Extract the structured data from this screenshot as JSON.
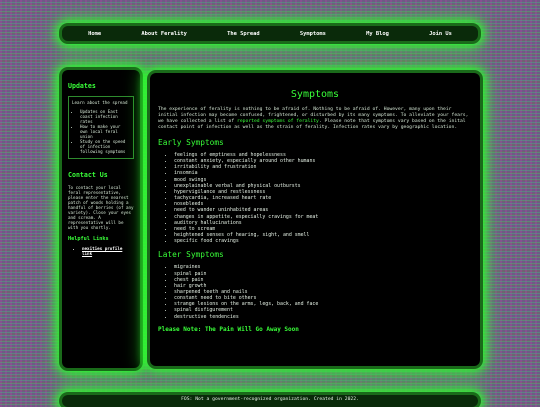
{
  "nav": {
    "items": [
      "Home",
      "About Ferality",
      "The Spread",
      "Symptoms",
      "My Blog",
      "Join Us"
    ]
  },
  "sidebar": {
    "updates_title": "Updates",
    "updates_intro": "Learn about the spread",
    "updates_items": [
      "Updates on East coast infection rates",
      "How to make your own local feral union",
      "Study on the speed of infection following symptoms"
    ],
    "contact_title": "Contact Us",
    "contact_text": "To contact your local feral representative, please enter the nearest patch of woods holding a handful of berries (of any variety). Close your eyes and scream. A representative will be with you shortly.",
    "helpful_title": "Helpful Links",
    "helpful_links": [
      "nexities profile link"
    ]
  },
  "main": {
    "title": "Symptoms",
    "intro_before": "The experience of ferality is nothing to be afraid of. Nothing to be afraid of. However, many upon their initial infection may become confused, frightened, or disturbed by its many symptoms. To alleviate your fears, we have collected a list of ",
    "intro_link": "reported symptoms of ferality",
    "intro_after": ". Please note that symptoms vary based on the inital contact point of infection as well as the strain of ferality. Infection rates vary by geographic location.",
    "early_title": "Early Symptoms",
    "early": [
      "feelings of emptiness and hopelessness",
      "constant anxiety, especially around other humans",
      "irritability and frustration",
      "insomnia",
      "mood swings",
      "unexplainable verbal and physical outbursts",
      "hypervigilance and restlessness",
      "tachycardia, increased heart rate",
      "nosebleeds",
      "need to wander uninhabited areas",
      "changes in appetite, especially cravings for meat",
      "auditory hallucinations",
      "need to scream",
      "heightened senses of hearing, sight, and smell",
      "specific food cravings"
    ],
    "later_title": "Later Symptoms",
    "later": [
      "migraines",
      "spinal pain",
      "chest pain",
      "hair growth",
      "sharpened teeth and nails",
      "constant need to bite others",
      "strange lesions on the arms, legs, back, and face",
      "spinal disfigurement",
      "destructive tendencies"
    ],
    "note": "Please Note: The Pain Will Go Away Soon"
  },
  "footer": {
    "text": "FOS: Not a government-recognized organization. Created in 2022."
  },
  "colors": {
    "accent": "#39ff39",
    "panel": "#000000",
    "glow": "#2cff2c"
  }
}
